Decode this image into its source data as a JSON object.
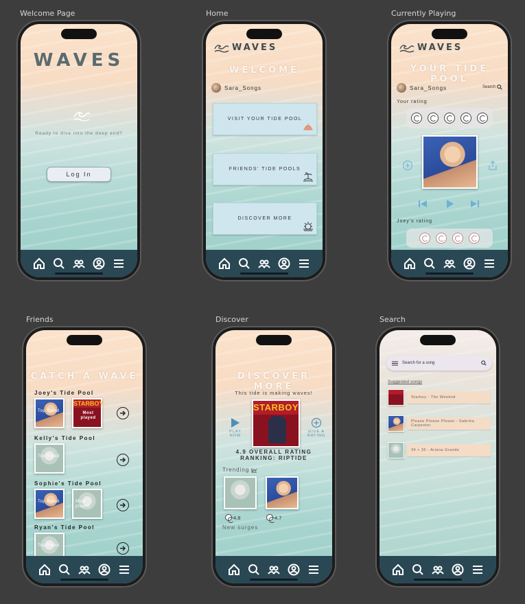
{
  "frames": {
    "welcome": "Welcome Page",
    "home": "Home",
    "playing": "Currently Playing",
    "friends": "Friends",
    "discover": "Discover",
    "search": "Search"
  },
  "brand": "WAVES",
  "welcome": {
    "tagline": "Ready to dive into the deep end?",
    "login": "Log In"
  },
  "home": {
    "heading": "WELCOME",
    "username": "Sara_Songs",
    "buttons": [
      "VISIT YOUR TIDE POOL",
      "FRIENDS' TIDE POOLS",
      "DISCOVER MORE"
    ]
  },
  "playing": {
    "heading": "YOUR TIDE POOL",
    "username": "Sara_Songs",
    "search": "Search",
    "your_rating_label": "Your rating",
    "your_rating": 5,
    "friend_rating_label": "Joey's rating",
    "friend_rating": 4
  },
  "friends": {
    "heading": "CATCH A WAVE",
    "pools": [
      {
        "name": "Joey's Tide Pool",
        "tiles": [
          "Top Rated",
          "Most played"
        ]
      },
      {
        "name": "Kelly's Tide Pool",
        "tiles": [
          "Top Rated"
        ]
      },
      {
        "name": "Sophie's Tide Pool",
        "tiles": [
          "Top Rated",
          "Most played"
        ]
      },
      {
        "name": "Ryan's Tide Pool",
        "tiles": [
          "Top Rated"
        ]
      }
    ],
    "starboy_cover": "STARBOY"
  },
  "discover": {
    "heading": "DISCOVER MORE",
    "subtitle": "This tide is making waves!",
    "play_now": "PLAY NOW",
    "give_rating": "GIVE A RATING",
    "starboy_cover": "STARBOY",
    "overall": "4.9 OVERALL RATING",
    "ranking": "RANKING: RIPTIDE",
    "trending": "Trending",
    "ratings": [
      "4.8",
      "4.7"
    ],
    "new_surges": "New surges"
  },
  "search": {
    "placeholder": "Search for a song",
    "suggested": "Suggested songs",
    "songs": [
      "Starboy - The Weeknd",
      "Please Please Please - Sabrina Carpenter",
      "34 + 35 - Ariana Grande"
    ]
  }
}
